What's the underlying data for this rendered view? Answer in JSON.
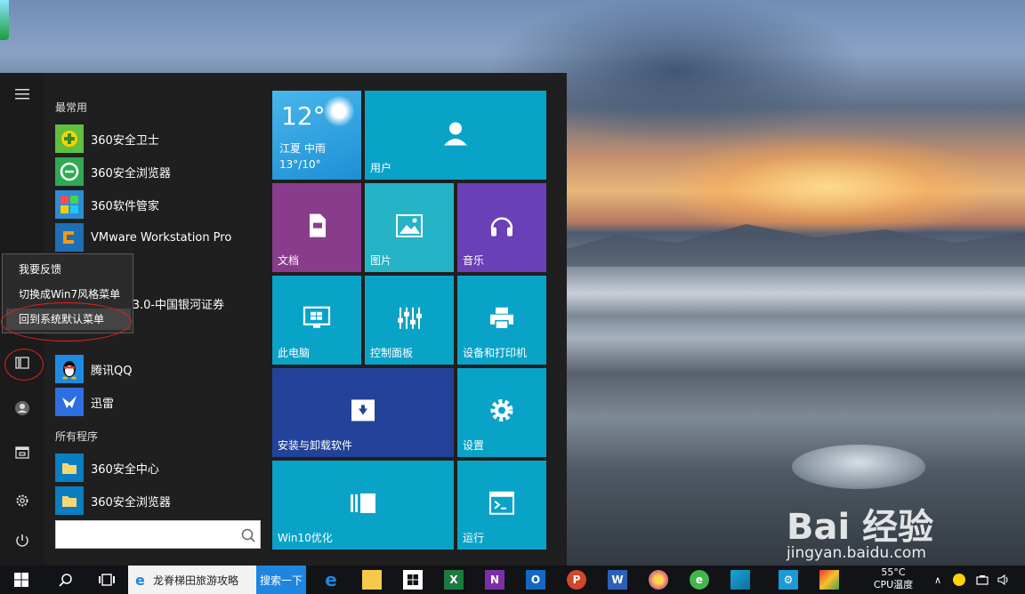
{
  "start_menu": {
    "most_used_label": "最常用",
    "all_programs_label": "所有程序",
    "apps": [
      {
        "label": "360安全卫士",
        "icon": "360-safeguard-icon",
        "color": "#5fbf3f"
      },
      {
        "label": "360安全浏览器",
        "icon": "360-browser-icon",
        "color": "#2faa52"
      },
      {
        "label": "360软件管家",
        "icon": "360-software-manager-icon",
        "color": "#2d8cd6"
      },
      {
        "label": "VMware Workstation Pro",
        "icon": "vmware-icon",
        "color": "#f39c12"
      },
      {
        "label": "融终端v3.0-中国银河证券",
        "icon": "galaxy-securities-icon",
        "color": "#b32b2b"
      },
      {
        "label": "腾讯QQ",
        "icon": "qq-penguin-icon",
        "color": "#1f8be0"
      },
      {
        "label": "迅雷",
        "icon": "xunlei-bird-icon",
        "color": "#2d6fe0"
      }
    ],
    "program_folders": [
      {
        "label": "360安全中心",
        "icon": "folder-icon"
      },
      {
        "label": "360安全浏览器",
        "icon": "folder-icon"
      }
    ],
    "search_placeholder": "",
    "rail_icons": [
      "hamburger-icon",
      "classic-menu-icon",
      "user-icon",
      "explorer-icon",
      "settings-icon",
      "power-icon"
    ]
  },
  "context_menu": {
    "items": [
      "我要反馈",
      "切换成Win7风格菜单",
      "回到系统默认菜单"
    ],
    "highlighted_index": 2
  },
  "tiles": {
    "weather": {
      "temp": "12°",
      "city": "江夏  中雨",
      "range": "13°/10°",
      "color": "#29a3e0"
    },
    "user": {
      "label": "用户",
      "color": "#0aa3c8"
    },
    "docs": {
      "label": "文档",
      "color": "#8a3c8c"
    },
    "pictures": {
      "label": "图片",
      "color": "#25b3c6"
    },
    "music": {
      "label": "音乐",
      "color": "#6b3fb5"
    },
    "this_pc": {
      "label": "此电脑",
      "color": "#0aa3c8"
    },
    "control_panel": {
      "label": "控制面板",
      "color": "#0aa3c8"
    },
    "devices": {
      "label": "设备和打印机",
      "color": "#0aa3c8"
    },
    "uninstall": {
      "label": "安装与卸载软件",
      "color": "#23439a"
    },
    "settings": {
      "label": "设置",
      "color": "#0aa3c8"
    },
    "win10": {
      "label": "Win10优化",
      "color": "#0aa3c8"
    },
    "run": {
      "label": "运行",
      "color": "#0aa3c8"
    }
  },
  "taskbar": {
    "browser_title": "龙脊梯田旅游攻略",
    "search_button": "搜索一下",
    "temperature": "55°C",
    "temperature_label": "CPU温度",
    "apps": [
      "edge-icon",
      "folder-icon",
      "store-icon",
      "excel-icon",
      "onenote-icon",
      "outlook-icon",
      "powerpoint-icon",
      "word-icon",
      "paint-icon",
      "360-icon",
      "photo-icon",
      "gear-icon",
      "media-icon"
    ]
  },
  "watermark": {
    "logo": "Bai  经验",
    "url": "jingyan.baidu.com"
  }
}
